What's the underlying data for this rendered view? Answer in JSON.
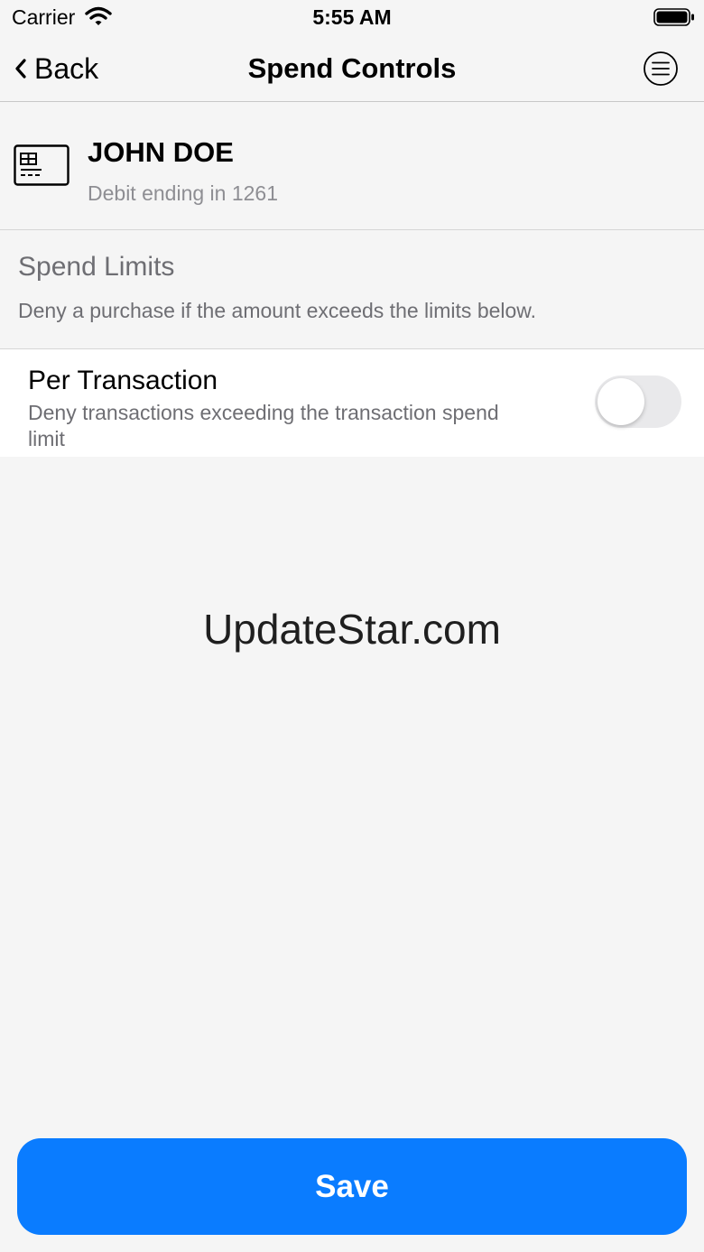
{
  "status_bar": {
    "carrier": "Carrier",
    "time": "5:55 AM",
    "wifi_icon": "wifi-icon",
    "battery_icon": "battery-icon"
  },
  "nav": {
    "back_label": "Back",
    "title": "Spend Controls",
    "menu_icon": "menu-circle-icon"
  },
  "card": {
    "icon": "card-icon",
    "name": "JOHN DOE",
    "subtitle": "Debit ending in 1261"
  },
  "section": {
    "title": "Spend Limits",
    "description": "Deny a purchase if the amount exceeds the limits below."
  },
  "rows": [
    {
      "title": "Per Transaction",
      "description": "Deny transactions exceeding the transaction spend limit",
      "enabled": false
    }
  ],
  "watermark": "UpdateStar.com",
  "save_label": "Save",
  "colors": {
    "accent": "#0a7cff",
    "background": "#f5f5f5",
    "toggle_off": "#e9e9eb"
  }
}
